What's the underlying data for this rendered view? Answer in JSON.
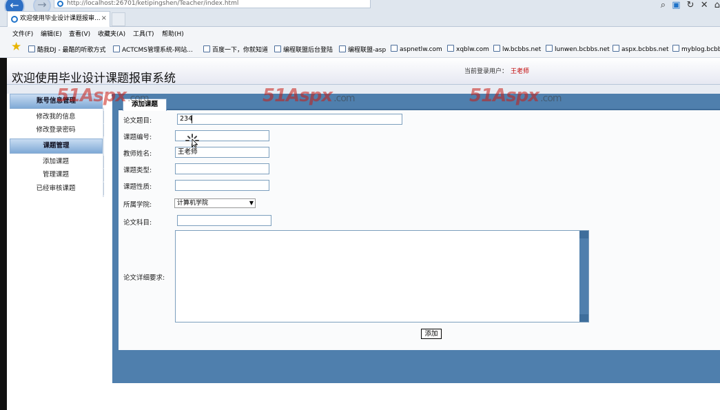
{
  "browser": {
    "url": "http://localhost:26701/ketipingshen/Teacher/index.html",
    "tab_title": "欢迎使用毕业设计课题报审...",
    "tab_close": "×",
    "back_glyph": "←",
    "forward_glyph": "→",
    "toolbar_icons": [
      "search-icon",
      "rss-icon",
      "refresh-icon",
      "stop-icon",
      "home-icon"
    ],
    "menu": [
      "文件(F)",
      "编辑(E)",
      "查看(V)",
      "收藏夹(A)",
      "工具(T)",
      "帮助(H)"
    ],
    "favorites": [
      "酷我DJ - 最酷的听歌方式",
      "ACTCMS管理系统-网站...",
      "百度一下，你就知道",
      "编程联盟后台登陆",
      "编程联盟-asp",
      "aspnetlw.com",
      "xqblw.com",
      "lw.bcbbs.net",
      "lunwen.bcbbs.net",
      "aspx.bcbbs.net",
      "myblog.bcbb"
    ]
  },
  "header": {
    "title": "欢迎使用毕业设计课题报审系统",
    "current_user_label": "当前登录用户：",
    "current_user_name": "王老师"
  },
  "watermark": {
    "brand": "51Aspx",
    "suffix": ".com"
  },
  "sidebar": {
    "sections": [
      {
        "title": "账号信息管理",
        "items": [
          "修改我的信息",
          "修改登录密码"
        ]
      },
      {
        "title": "课题管理",
        "items": [
          "添加课题",
          "管理课题",
          "已经审核课题"
        ]
      }
    ]
  },
  "form": {
    "tab_label": "添加课题",
    "fields": {
      "thesis_title": {
        "label": "论文题目:",
        "value": "234"
      },
      "topic_number": {
        "label": "课题编号:",
        "value": ""
      },
      "teacher_name": {
        "label": "教师姓名:",
        "value": "王老师"
      },
      "topic_type": {
        "label": "课题类型:",
        "value": ""
      },
      "topic_nature": {
        "label": "课题性质:",
        "value": ""
      },
      "college": {
        "label": "所属学院:",
        "value": "计算机学院"
      },
      "subject": {
        "label": "论文科目:",
        "value": ""
      },
      "details": {
        "label": "论文详细要求:",
        "value": ""
      }
    },
    "submit_label": "添加"
  },
  "colors": {
    "accent_blue": "#4f7fad",
    "user_name_red": "#c00000",
    "watermark_red": "#c81e14"
  }
}
